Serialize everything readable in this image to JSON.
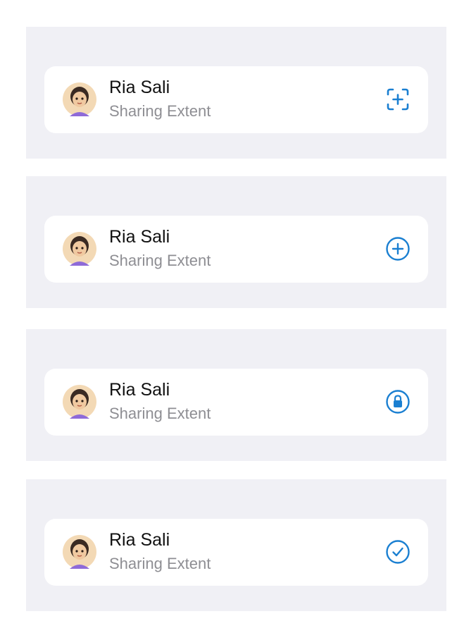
{
  "colors": {
    "panel_background": "#f0f0f5",
    "card_background": "#ffffff",
    "accent": "#1a7fd1",
    "name_text": "#111111",
    "subtitle_text": "#8e8e93"
  },
  "rows": [
    {
      "name": "Ria Sali",
      "subtitle": "Sharing Extent",
      "avatar": "memoji-avatar",
      "action_icon": "scan-add-icon"
    },
    {
      "name": "Ria Sali",
      "subtitle": "Sharing Extent",
      "avatar": "memoji-avatar",
      "action_icon": "plus-circle-icon"
    },
    {
      "name": "Ria Sali",
      "subtitle": "Sharing Extent",
      "avatar": "memoji-avatar",
      "action_icon": "lock-circle-icon"
    },
    {
      "name": "Ria Sali",
      "subtitle": "Sharing Extent",
      "avatar": "memoji-avatar",
      "action_icon": "checkmark-circle-icon"
    }
  ]
}
